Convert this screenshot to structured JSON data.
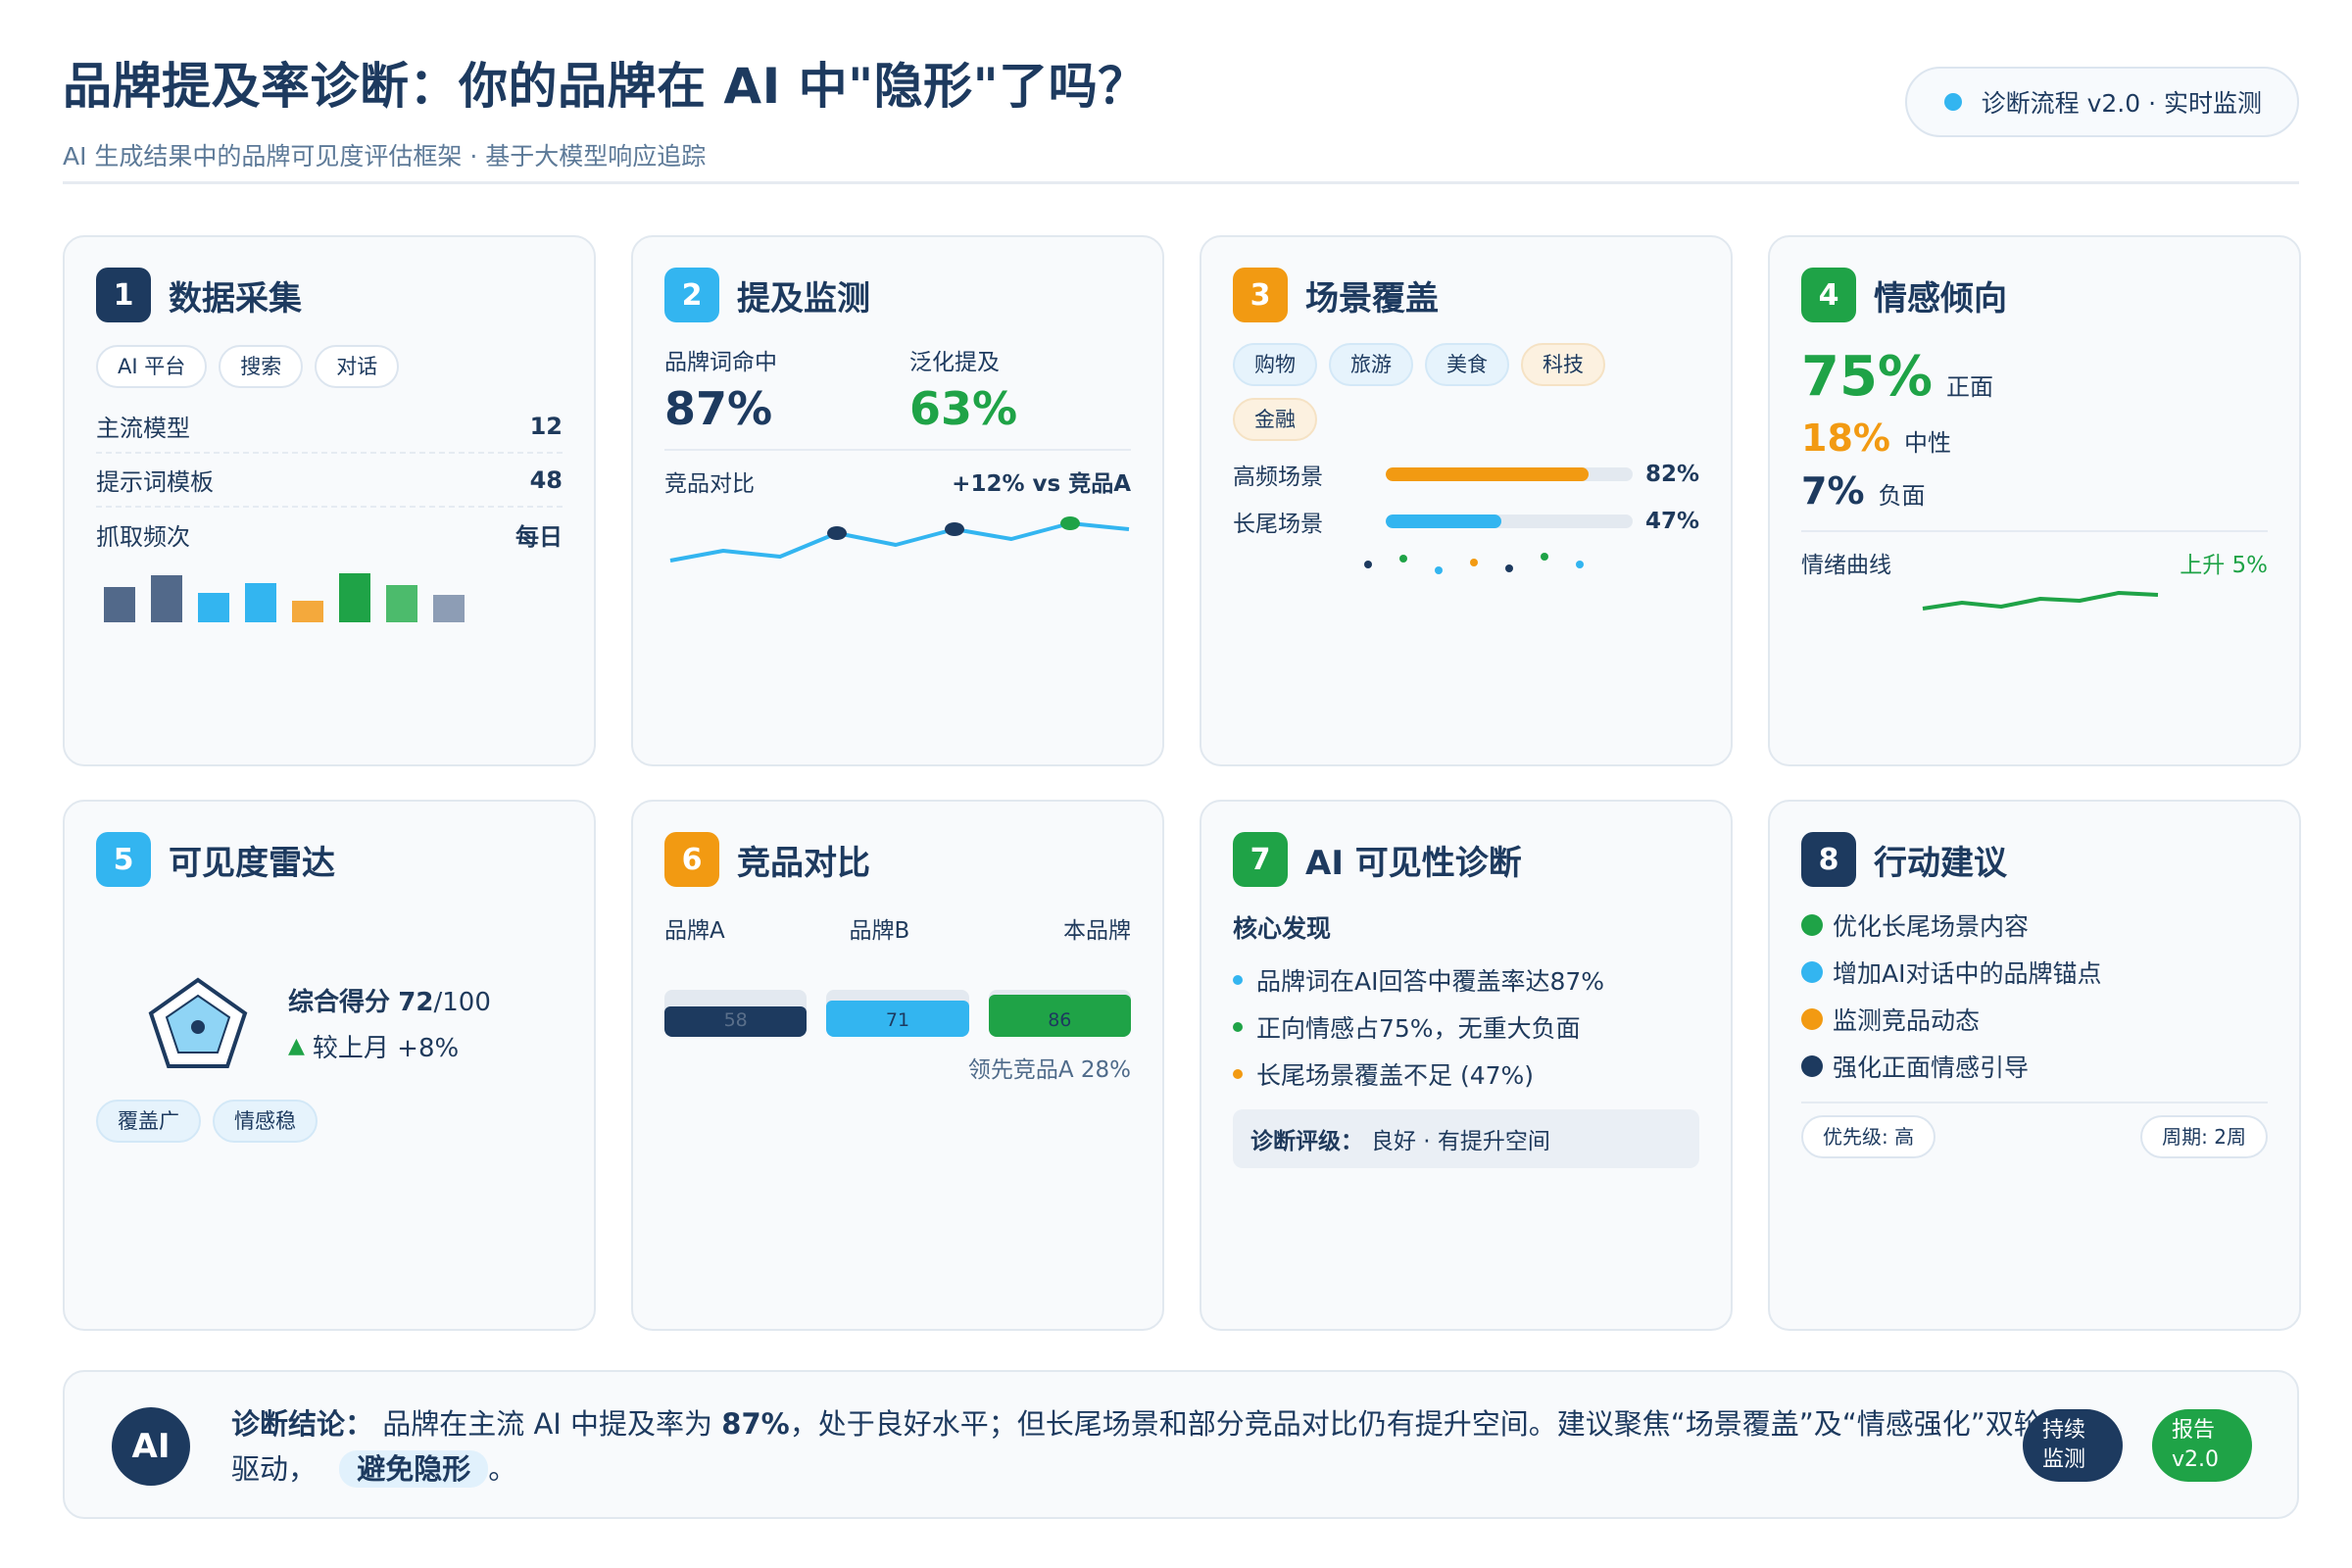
{
  "header": {
    "title": "品牌提及率诊断：你的品牌在 AI 中\"隐形\"了吗？",
    "subtitle": "AI 生成结果中的品牌可见度评估框架 · 基于大模型响应追踪",
    "status": "诊断流程 v2.0 · 实时监测"
  },
  "colors": {
    "navy": "#1d3a5f",
    "sky": "#33b5f0",
    "orange": "#f29a12",
    "green": "#1fa347"
  },
  "cards": {
    "c1": {
      "num": "1",
      "title": "数据采集",
      "chips": [
        "AI 平台",
        "搜索",
        "对话"
      ],
      "rows": [
        {
          "k": "主流模型",
          "v": "12"
        },
        {
          "k": "提示词模板",
          "v": "48"
        },
        {
          "k": "抓取频次",
          "v": "每日"
        }
      ]
    },
    "c2": {
      "num": "2",
      "title": "提及监测",
      "m1_label": "品牌词命中",
      "m1_value": "87%",
      "m2_label": "泛化提及",
      "m2_value": "63%",
      "compare_label": "竞品对比",
      "compare_value": "+12% vs 竞品A"
    },
    "c3": {
      "num": "3",
      "title": "场景覆盖",
      "chips": [
        "购物",
        "旅游",
        "美食",
        "科技",
        "金融"
      ],
      "bars": [
        {
          "label": "高频场景",
          "value": "82%",
          "fraction": 0.82,
          "color": "#f29a12"
        },
        {
          "label": "长尾场景",
          "value": "47%",
          "fraction": 0.47,
          "color": "#33b5f0"
        }
      ]
    },
    "c4": {
      "num": "4",
      "title": "情感倾向",
      "pos_value": "75%",
      "pos_label": "正面",
      "neu_value": "18%",
      "neu_label": "中性",
      "neg_value": "7%",
      "neg_label": "负面",
      "curve_label": "情绪曲线",
      "curve_trend": "上升 5%"
    },
    "c5": {
      "num": "5",
      "title": "可见度雷达",
      "score_label": "综合得分",
      "score_value": "72",
      "score_max": "/100",
      "change": "较上月 +8%",
      "chips": [
        "覆盖广",
        "情感稳"
      ]
    },
    "c6": {
      "num": "6",
      "title": "竞品对比",
      "brands": [
        {
          "name": "品牌A",
          "value": "58",
          "color": "#1d3a5f"
        },
        {
          "name": "品牌B",
          "value": "71",
          "color": "#33b5f0"
        },
        {
          "name": "本品牌",
          "value": "86",
          "color": "#1fa347"
        }
      ],
      "note": "领先竞品A 28%"
    },
    "c7": {
      "num": "7",
      "title": "AI 可见性诊断",
      "subhead": "核心发现",
      "findings": [
        {
          "text": "品牌词在AI回答中覆盖率达87%",
          "color": "#33b5f0"
        },
        {
          "text": "正向情感占75%，无重大负面",
          "color": "#1fa347"
        },
        {
          "text": "长尾场景覆盖不足 (47%)",
          "color": "#f29a12"
        }
      ],
      "rating_label": "诊断评级：",
      "rating_value": "良好 · 有提升空间"
    },
    "c8": {
      "num": "8",
      "title": "行动建议",
      "actions": [
        {
          "text": "优化长尾场景内容",
          "color": "#1fa347"
        },
        {
          "text": "增加AI对话中的品牌锚点",
          "color": "#33b5f0"
        },
        {
          "text": "监测竞品动态",
          "color": "#f29a12"
        },
        {
          "text": "强化正面情感引导",
          "color": "#1d3a5f"
        }
      ],
      "priority": "优先级: 高",
      "cycle": "周期: 2周"
    }
  },
  "footer": {
    "badge": "AI",
    "label": "诊断结论：",
    "text_a": "品牌在主流 AI 中提及率为",
    "text_b": "87%",
    "text_c": "，处于良好水平；但长尾场景和部分竞品对比仍有提升空间。建议聚焦“场景覆盖”及“情感强化”双轮驱动，",
    "highlight": "避免隐形",
    "end": "。",
    "btn1_l1": "持续",
    "btn1_l2": "监测",
    "btn2_l1": "报告",
    "btn2_l2": "v2.0"
  }
}
